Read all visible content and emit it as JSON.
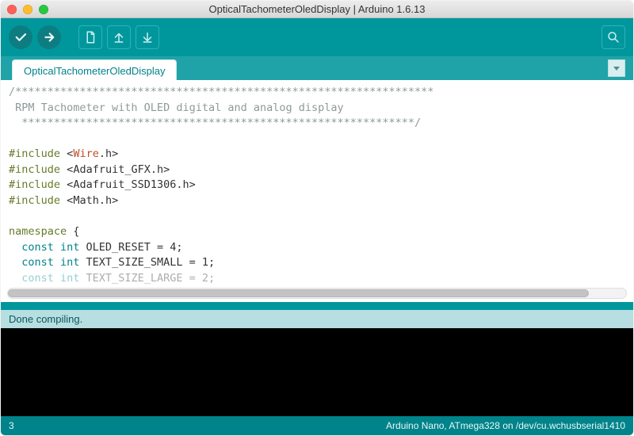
{
  "window": {
    "title": "OpticalTachometerOledDisplay | Arduino 1.6.13"
  },
  "tab": {
    "name": "OpticalTachometerOledDisplay"
  },
  "code": {
    "comment_top": "/*****************************************************************",
    "comment_body": " RPM Tachometer with OLED digital and analog display",
    "comment_bottom": "  *************************************************************/",
    "inc": "#include",
    "lt": "<",
    "gt": ">",
    "dot_h": ".h",
    "lib1": "Wire",
    "lib2": "Adafruit_GFX",
    "lib3": "Adafruit_SSD1306",
    "lib4": "Math",
    "ns": "namespace",
    "brace": " {",
    "ci": "const int",
    "d1": " OLED_RESET = 4;",
    "d2": " TEXT_SIZE_SMALL = 1;",
    "d3": " TEXT_SIZE_LARGE = 2;"
  },
  "status": {
    "msg": "Done compiling."
  },
  "footer": {
    "line": "3",
    "board": "Arduino Nano, ATmega328 on /dev/cu.wchusbserial1410"
  }
}
